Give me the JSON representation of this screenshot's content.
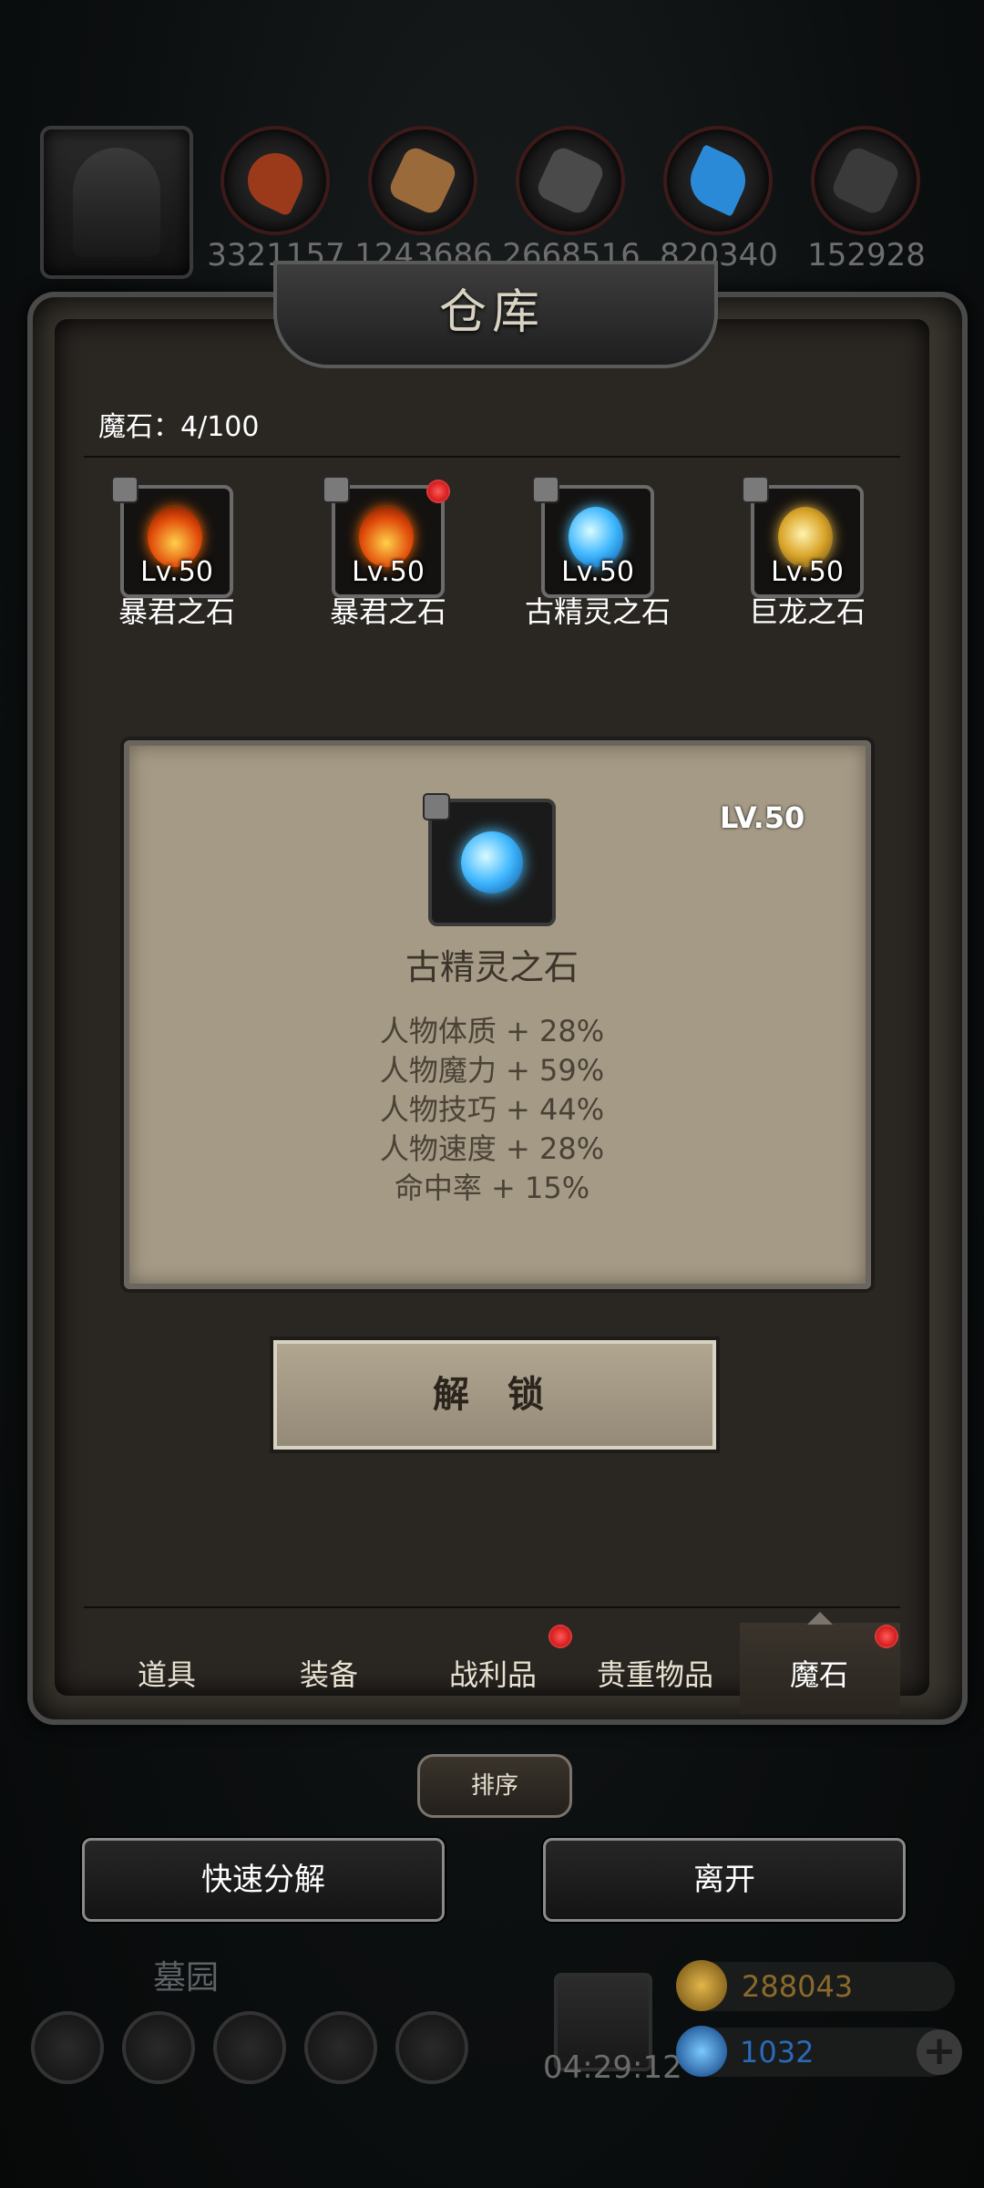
{
  "resources": [
    {
      "icon": "character-helmet-icon"
    },
    {
      "icon": "meat-icon",
      "value": "3321157",
      "color": "#9a3a1a"
    },
    {
      "icon": "wood-icon",
      "value": "1243686",
      "color": "#9a6a3a"
    },
    {
      "icon": "stone-icon",
      "value": "2668516",
      "color": "#4a4a4a"
    },
    {
      "icon": "crystal-icon",
      "value": "820340",
      "color": "#2a8ad8"
    },
    {
      "icon": "iron-icon",
      "value": "152928",
      "color": "#3a3a3a"
    }
  ],
  "panel": {
    "title": "仓库",
    "stone_count": "魔石：4/100"
  },
  "stones": [
    {
      "name": "暴君之石",
      "level": "Lv.50",
      "locked": true,
      "new": false,
      "gem": "fire"
    },
    {
      "name": "暴君之石",
      "level": "Lv.50",
      "locked": true,
      "new": true,
      "gem": "fire"
    },
    {
      "name": "古精灵之石",
      "level": "Lv.50",
      "locked": true,
      "new": false,
      "gem": "ice"
    },
    {
      "name": "巨龙之石",
      "level": "Lv.50",
      "locked": true,
      "new": false,
      "gem": "gold"
    }
  ],
  "detail": {
    "name": "古精灵之石",
    "level": "LV.50",
    "stats": [
      "人物体质 + 28%",
      "人物魔力 + 59%",
      "人物技巧 + 44%",
      "人物速度 + 28%",
      "命中率 + 15%"
    ],
    "unlock_label": "解 锁"
  },
  "tabs": [
    {
      "label": "道具",
      "badge": false
    },
    {
      "label": "装备",
      "badge": false
    },
    {
      "label": "战利品",
      "badge": true
    },
    {
      "label": "贵重物品",
      "badge": false
    },
    {
      "label": "魔石",
      "badge": true,
      "active": true
    }
  ],
  "sort_label": "排序",
  "actions": {
    "quick_decompose": "快速分解",
    "leave": "离开"
  },
  "hud": {
    "zone": "墓园",
    "timer": "04:29:12",
    "gold": "288043",
    "gems": "1032",
    "plus": "+"
  },
  "colors": {
    "gold_text": "#8a6a2a",
    "gem_text": "#2a6ab8",
    "badge_red": "#d01010"
  }
}
